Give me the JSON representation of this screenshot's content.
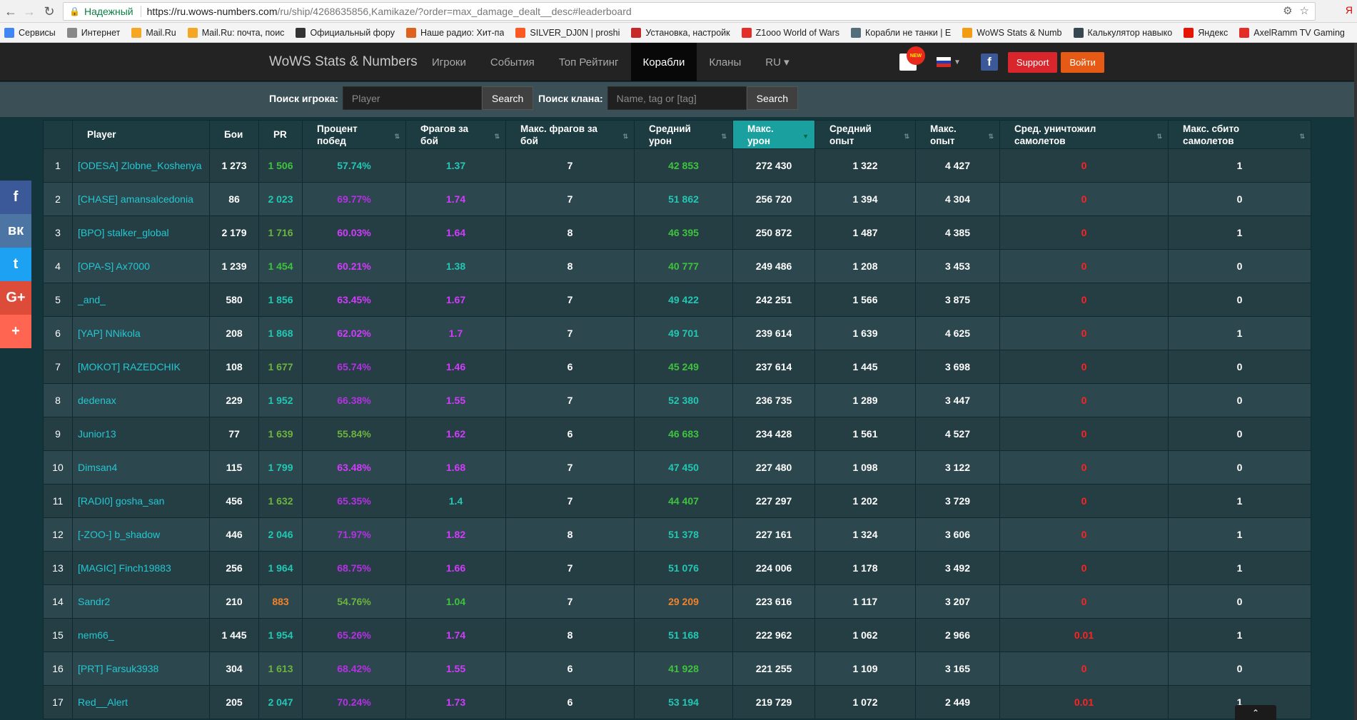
{
  "browser": {
    "secure_label": "Надежный",
    "url_host": "https://ru.wows-numbers.com",
    "url_path": "/ru/ship/4268635856,Kamikaze/?order=max_damage_dealt__desc#leaderboard",
    "corner_glyph": "Я"
  },
  "bookmarks": [
    {
      "label": "Сервисы",
      "icon": "apps-icon",
      "color": "#4285f4"
    },
    {
      "label": "Интернет",
      "icon": "page-icon",
      "color": "#888888"
    },
    {
      "label": "Mail.Ru",
      "icon": "mailru-icon",
      "color": "#f5a623"
    },
    {
      "label": "Mail.Ru: почта, поис",
      "icon": "mailru-icon",
      "color": "#f5a623"
    },
    {
      "label": "Официальный фору",
      "icon": "wows-icon",
      "color": "#333333"
    },
    {
      "label": "Наше радио: Хит-па",
      "icon": "radio-icon",
      "color": "#e06020"
    },
    {
      "label": "SILVER_DJ0N | proshi",
      "icon": "silver-icon",
      "color": "#ff5722"
    },
    {
      "label": "Установка, настройк",
      "icon": "tool-icon",
      "color": "#c62828"
    },
    {
      "label": "Z1ooo World of Wars",
      "icon": "youtube-icon",
      "color": "#e52d27"
    },
    {
      "label": "Корабли не танки | Е",
      "icon": "ship-icon",
      "color": "#546e7a"
    },
    {
      "label": "WoWS Stats & Numb",
      "icon": "wowsnumbers-icon",
      "color": "#f39c12"
    },
    {
      "label": "Калькулятор навыко",
      "icon": "anchor-icon",
      "color": "#37474f"
    },
    {
      "label": "Яндекс",
      "icon": "yandex-icon",
      "color": "#e61400"
    },
    {
      "label": "AxelRamm TV Gaming",
      "icon": "youtube-icon",
      "color": "#e52d27"
    }
  ],
  "navbar": {
    "brand": "WoWS Stats & Numbers",
    "items": [
      {
        "label": "Игроки",
        "active": false
      },
      {
        "label": "События",
        "active": false
      },
      {
        "label": "Топ Рейтинг",
        "active": false
      },
      {
        "label": "Корабли",
        "active": true
      },
      {
        "label": "Кланы",
        "active": false
      },
      {
        "label": "RU ▾",
        "active": false
      }
    ],
    "notif_badge": "NEW",
    "support": "Support",
    "login": "Войти"
  },
  "search": {
    "player_label": "Поиск игрока:",
    "player_placeholder": "Player",
    "clan_label": "Поиск клана:",
    "clan_placeholder": "Name, tag or [tag]",
    "button": "Search"
  },
  "social": [
    {
      "name": "facebook-share-button",
      "glyph": "f",
      "color": "#3b5998"
    },
    {
      "name": "vk-share-button",
      "glyph": "вк",
      "color": "#4c75a3"
    },
    {
      "name": "twitter-share-button",
      "glyph": "t",
      "color": "#1da1f2"
    },
    {
      "name": "googleplus-share-button",
      "glyph": "G+",
      "color": "#dd4b39"
    },
    {
      "name": "more-share-button",
      "glyph": "+",
      "color": "#ff6550"
    }
  ],
  "colors": {
    "player": "#24c7d2",
    "green": "#3fc33f",
    "lime": "#6db33f",
    "teal": "#22c8b4",
    "purple": "#b730e6",
    "magenta": "#d43aff",
    "orange": "#f0832a",
    "red": "#ff2222",
    "white": "#ffffff"
  },
  "table": {
    "headers": [
      "",
      "Player",
      "Бои",
      "PR",
      "Процент\nпобед",
      "Фрагов за\nбой",
      "Макс. фрагов за\nбой",
      "Средний\nурон",
      "Макс.\nурон",
      "Средний\nопыт",
      "Макс.\nопыт",
      "Сред. уничтожил\nсамолетов",
      "Макс. сбито\nсамолетов"
    ],
    "sorted_column": 8,
    "rows": [
      {
        "rank": "1",
        "player": "[ODESA] Zlobne_Koshenya",
        "battles": "1 273",
        "pr": "1 506",
        "pr_c": "green",
        "winrate": "57.74%",
        "wr_c": "teal",
        "frags": "1.37",
        "fr_c": "teal",
        "max_frags": "7",
        "avg_dmg": "42 853",
        "ad_c": "green",
        "max_dmg": "272 430",
        "avg_xp": "1 322",
        "max_xp": "4 427",
        "avg_planes": "0",
        "max_planes": "1"
      },
      {
        "rank": "2",
        "player": "[CHASE] amansalcedonia",
        "battles": "86",
        "pr": "2 023",
        "pr_c": "teal",
        "winrate": "69.77%",
        "wr_c": "purple",
        "frags": "1.74",
        "fr_c": "magenta",
        "max_frags": "7",
        "avg_dmg": "51 862",
        "ad_c": "teal",
        "max_dmg": "256 720",
        "avg_xp": "1 394",
        "max_xp": "4 304",
        "avg_planes": "0",
        "max_planes": "0"
      },
      {
        "rank": "3",
        "player": "[BPO] stalker_global",
        "battles": "2 179",
        "pr": "1 716",
        "pr_c": "lime",
        "winrate": "60.03%",
        "wr_c": "magenta",
        "frags": "1.64",
        "fr_c": "magenta",
        "max_frags": "8",
        "avg_dmg": "46 395",
        "ad_c": "green",
        "max_dmg": "250 872",
        "avg_xp": "1 487",
        "max_xp": "4 385",
        "avg_planes": "0",
        "max_planes": "1"
      },
      {
        "rank": "4",
        "player": "[OPA-S] Ax7000",
        "battles": "1 239",
        "pr": "1 454",
        "pr_c": "green",
        "winrate": "60.21%",
        "wr_c": "magenta",
        "frags": "1.38",
        "fr_c": "teal",
        "max_frags": "8",
        "avg_dmg": "40 777",
        "ad_c": "green",
        "max_dmg": "249 486",
        "avg_xp": "1 208",
        "max_xp": "3 453",
        "avg_planes": "0",
        "max_planes": "0"
      },
      {
        "rank": "5",
        "player": "_and_",
        "battles": "580",
        "pr": "1 856",
        "pr_c": "teal",
        "winrate": "63.45%",
        "wr_c": "magenta",
        "frags": "1.67",
        "fr_c": "magenta",
        "max_frags": "7",
        "avg_dmg": "49 422",
        "ad_c": "teal",
        "max_dmg": "242 251",
        "avg_xp": "1 566",
        "max_xp": "3 875",
        "avg_planes": "0",
        "max_planes": "0"
      },
      {
        "rank": "6",
        "player": "[YAP] NNikola",
        "battles": "208",
        "pr": "1 868",
        "pr_c": "teal",
        "winrate": "62.02%",
        "wr_c": "magenta",
        "frags": "1.7",
        "fr_c": "magenta",
        "max_frags": "7",
        "avg_dmg": "49 701",
        "ad_c": "teal",
        "max_dmg": "239 614",
        "avg_xp": "1 639",
        "max_xp": "4 625",
        "avg_planes": "0",
        "max_planes": "1"
      },
      {
        "rank": "7",
        "player": "[MOKOT] RAZEDCHIK",
        "battles": "108",
        "pr": "1 677",
        "pr_c": "lime",
        "winrate": "65.74%",
        "wr_c": "purple",
        "frags": "1.46",
        "fr_c": "magenta",
        "max_frags": "6",
        "avg_dmg": "45 249",
        "ad_c": "green",
        "max_dmg": "237 614",
        "avg_xp": "1 445",
        "max_xp": "3 698",
        "avg_planes": "0",
        "max_planes": "0"
      },
      {
        "rank": "8",
        "player": "dedenax",
        "battles": "229",
        "pr": "1 952",
        "pr_c": "teal",
        "winrate": "66.38%",
        "wr_c": "purple",
        "frags": "1.55",
        "fr_c": "magenta",
        "max_frags": "7",
        "avg_dmg": "52 380",
        "ad_c": "teal",
        "max_dmg": "236 735",
        "avg_xp": "1 289",
        "max_xp": "3 447",
        "avg_planes": "0",
        "max_planes": "0"
      },
      {
        "rank": "9",
        "player": "Junior13",
        "battles": "77",
        "pr": "1 639",
        "pr_c": "lime",
        "winrate": "55.84%",
        "wr_c": "lime",
        "frags": "1.62",
        "fr_c": "magenta",
        "max_frags": "6",
        "avg_dmg": "46 683",
        "ad_c": "green",
        "max_dmg": "234 428",
        "avg_xp": "1 561",
        "max_xp": "4 527",
        "avg_planes": "0",
        "max_planes": "0"
      },
      {
        "rank": "10",
        "player": "Dimsan4",
        "battles": "115",
        "pr": "1 799",
        "pr_c": "teal",
        "winrate": "63.48%",
        "wr_c": "magenta",
        "frags": "1.68",
        "fr_c": "magenta",
        "max_frags": "7",
        "avg_dmg": "47 450",
        "ad_c": "teal",
        "max_dmg": "227 480",
        "avg_xp": "1 098",
        "max_xp": "3 122",
        "avg_planes": "0",
        "max_planes": "0"
      },
      {
        "rank": "11",
        "player": "[RADI0] gosha_san",
        "battles": "456",
        "pr": "1 632",
        "pr_c": "lime",
        "winrate": "65.35%",
        "wr_c": "purple",
        "frags": "1.4",
        "fr_c": "teal",
        "max_frags": "7",
        "avg_dmg": "44 407",
        "ad_c": "green",
        "max_dmg": "227 297",
        "avg_xp": "1 202",
        "max_xp": "3 729",
        "avg_planes": "0",
        "max_planes": "1"
      },
      {
        "rank": "12",
        "player": "[-ZOO-] b_shadow",
        "battles": "446",
        "pr": "2 046",
        "pr_c": "teal",
        "winrate": "71.97%",
        "wr_c": "purple",
        "frags": "1.82",
        "fr_c": "magenta",
        "max_frags": "8",
        "avg_dmg": "51 378",
        "ad_c": "teal",
        "max_dmg": "227 161",
        "avg_xp": "1 324",
        "max_xp": "3 606",
        "avg_planes": "0",
        "max_planes": "1"
      },
      {
        "rank": "13",
        "player": "[MAGIC] Finch19883",
        "battles": "256",
        "pr": "1 964",
        "pr_c": "teal",
        "winrate": "68.75%",
        "wr_c": "purple",
        "frags": "1.66",
        "fr_c": "magenta",
        "max_frags": "7",
        "avg_dmg": "51 076",
        "ad_c": "teal",
        "max_dmg": "224 006",
        "avg_xp": "1 178",
        "max_xp": "3 492",
        "avg_planes": "0",
        "max_planes": "1"
      },
      {
        "rank": "14",
        "player": "Sandr2",
        "battles": "210",
        "pr": "883",
        "pr_c": "orange",
        "winrate": "54.76%",
        "wr_c": "lime",
        "frags": "1.04",
        "fr_c": "green",
        "max_frags": "7",
        "avg_dmg": "29 209",
        "ad_c": "orange",
        "max_dmg": "223 616",
        "avg_xp": "1 117",
        "max_xp": "3 207",
        "avg_planes": "0",
        "max_planes": "0"
      },
      {
        "rank": "15",
        "player": "nem66_",
        "battles": "1 445",
        "pr": "1 954",
        "pr_c": "teal",
        "winrate": "65.26%",
        "wr_c": "purple",
        "frags": "1.74",
        "fr_c": "magenta",
        "max_frags": "8",
        "avg_dmg": "51 168",
        "ad_c": "teal",
        "max_dmg": "222 962",
        "avg_xp": "1 062",
        "max_xp": "2 966",
        "avg_planes": "0.01",
        "max_planes": "1"
      },
      {
        "rank": "16",
        "player": "[PRT] Farsuk3938",
        "battles": "304",
        "pr": "1 613",
        "pr_c": "lime",
        "winrate": "68.42%",
        "wr_c": "purple",
        "frags": "1.55",
        "fr_c": "magenta",
        "max_frags": "6",
        "avg_dmg": "41 928",
        "ad_c": "green",
        "max_dmg": "221 255",
        "avg_xp": "1 109",
        "max_xp": "3 165",
        "avg_planes": "0",
        "max_planes": "0"
      },
      {
        "rank": "17",
        "player": "Red__Alert",
        "battles": "205",
        "pr": "2 047",
        "pr_c": "teal",
        "winrate": "70.24%",
        "wr_c": "purple",
        "frags": "1.73",
        "fr_c": "magenta",
        "max_frags": "6",
        "avg_dmg": "53 194",
        "ad_c": "teal",
        "max_dmg": "219 729",
        "avg_xp": "1 072",
        "max_xp": "2 449",
        "avg_planes": "0.01",
        "max_planes": "1"
      }
    ]
  }
}
